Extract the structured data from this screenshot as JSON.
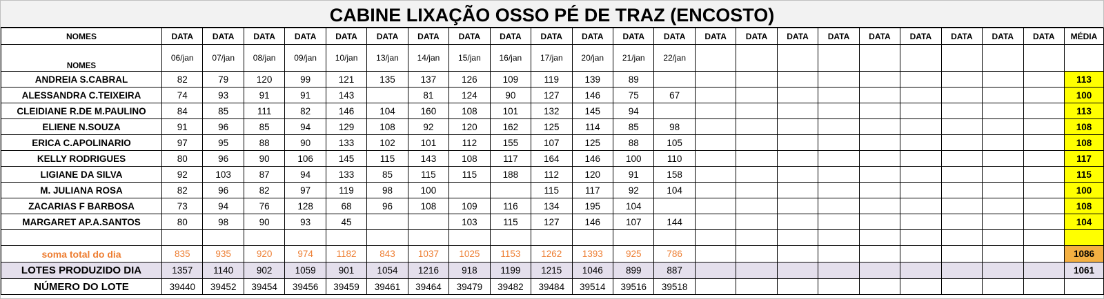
{
  "title": "CABINE LIXAÇÃO OSSO PÉ DE TRAZ (ENCOSTO)",
  "header": {
    "nomes_label": "NOMES",
    "data_label": "DATA",
    "media_label": "MÉDIA",
    "dates": [
      "06/jan",
      "07/jan",
      "08/jan",
      "09/jan",
      "10/jan",
      "13/jan",
      "14/jan",
      "15/jan",
      "16/jan",
      "17/jan",
      "20/jan",
      "21/jan",
      "22/jan",
      "",
      "",
      "",
      "",
      "",
      "",
      "",
      "",
      ""
    ]
  },
  "rows": [
    {
      "name": "ANDREIA S.CABRAL",
      "values": [
        "82",
        "79",
        "120",
        "99",
        "121",
        "135",
        "137",
        "126",
        "109",
        "119",
        "139",
        "89",
        "",
        "",
        "",
        "",
        "",
        "",
        "",
        "",
        "",
        ""
      ],
      "media": "113"
    },
    {
      "name": "ALESSANDRA C.TEIXEIRA",
      "values": [
        "74",
        "93",
        "91",
        "91",
        "143",
        "",
        "81",
        "124",
        "90",
        "127",
        "146",
        "75",
        "67",
        "",
        "",
        "",
        "",
        "",
        "",
        "",
        "",
        ""
      ],
      "media": "100"
    },
    {
      "name": "CLEIDIANE R.DE M.PAULINO",
      "values": [
        "84",
        "85",
        "111",
        "82",
        "146",
        "104",
        "160",
        "108",
        "101",
        "132",
        "145",
        "94",
        "",
        "",
        "",
        "",
        "",
        "",
        "",
        "",
        "",
        ""
      ],
      "media": "113"
    },
    {
      "name": "ELIENE N.SOUZA",
      "values": [
        "91",
        "96",
        "85",
        "94",
        "129",
        "108",
        "92",
        "120",
        "162",
        "125",
        "114",
        "85",
        "98",
        "",
        "",
        "",
        "",
        "",
        "",
        "",
        "",
        ""
      ],
      "media": "108"
    },
    {
      "name": "ERICA C.APOLINARIO",
      "values": [
        "97",
        "95",
        "88",
        "90",
        "133",
        "102",
        "101",
        "112",
        "155",
        "107",
        "125",
        "88",
        "105",
        "",
        "",
        "",
        "",
        "",
        "",
        "",
        "",
        ""
      ],
      "media": "108"
    },
    {
      "name": "KELLY RODRIGUES",
      "values": [
        "80",
        "96",
        "90",
        "106",
        "145",
        "115",
        "143",
        "108",
        "117",
        "164",
        "146",
        "100",
        "110",
        "",
        "",
        "",
        "",
        "",
        "",
        "",
        "",
        ""
      ],
      "media": "117"
    },
    {
      "name": "LIGIANE DA SILVA",
      "values": [
        "92",
        "103",
        "87",
        "94",
        "133",
        "85",
        "115",
        "115",
        "188",
        "112",
        "120",
        "91",
        "158",
        "",
        "",
        "",
        "",
        "",
        "",
        "",
        "",
        ""
      ],
      "media": "115"
    },
    {
      "name": "M. JULIANA ROSA",
      "values": [
        "82",
        "96",
        "82",
        "97",
        "119",
        "98",
        "100",
        "",
        "",
        "115",
        "117",
        "92",
        "104",
        "",
        "",
        "",
        "",
        "",
        "",
        "",
        "",
        ""
      ],
      "media": "100"
    },
    {
      "name": "ZACARIAS F BARBOSA",
      "values": [
        "73",
        "94",
        "76",
        "128",
        "68",
        "96",
        "108",
        "109",
        "116",
        "134",
        "195",
        "104",
        "",
        "",
        "",
        "",
        "",
        "",
        "",
        "",
        "",
        ""
      ],
      "media": "108"
    },
    {
      "name": "MARGARET AP.A.SANTOS",
      "values": [
        "80",
        "98",
        "90",
        "93",
        "45",
        "",
        "",
        "103",
        "115",
        "127",
        "146",
        "107",
        "144",
        "",
        "",
        "",
        "",
        "",
        "",
        "",
        "",
        ""
      ],
      "media": "104"
    }
  ],
  "soma": {
    "label": "soma total  do dia",
    "values": [
      "835",
      "935",
      "920",
      "974",
      "1182",
      "843",
      "1037",
      "1025",
      "1153",
      "1262",
      "1393",
      "925",
      "786",
      "",
      "",
      "",
      "",
      "",
      "",
      "",
      "",
      ""
    ],
    "media": "1086"
  },
  "lotes": {
    "label": "LOTES PRODUZIDO DIA",
    "values": [
      "1357",
      "1140",
      "902",
      "1059",
      "901",
      "1054",
      "1216",
      "918",
      "1199",
      "1215",
      "1046",
      "899",
      "887",
      "",
      "",
      "",
      "",
      "",
      "",
      "",
      "",
      ""
    ],
    "media": "1061"
  },
  "numero": {
    "label": "NÚMERO DO LOTE",
    "values": [
      "39440",
      "39452",
      "39454",
      "39456",
      "39459",
      "39461",
      "39464",
      "39479",
      "39482",
      "39484",
      "39514",
      "39516",
      "39518",
      "",
      "",
      "",
      "",
      "",
      "",
      "",
      "",
      ""
    ],
    "media": ""
  },
  "colors": {
    "media_yellow": "#ffff00",
    "media_orange": "#f4b042",
    "soma_text": "#ed7d31",
    "lotes_fill": "#e4dfec"
  }
}
